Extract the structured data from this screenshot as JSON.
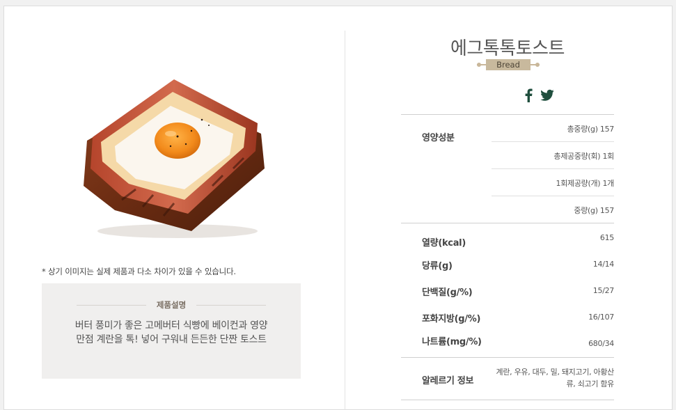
{
  "product": {
    "name": "에그톡톡토스트",
    "category": "Bread",
    "image_note": "* 상기 이미지는 실제 제품과 다소 차이가 있을 수 있습니다."
  },
  "description": {
    "title": "제품설명",
    "text": "버터 풍미가 좋은 고메버터 식빵에 베이컨과 영양만점 계란을 톡! 넣어 구워내 든든한 단짠 토스트"
  },
  "social": {
    "icons": [
      "facebook-icon",
      "twitter-icon"
    ],
    "color": "#1f4e3d"
  },
  "nutrition": {
    "section_label": "영양성분",
    "serving": [
      {
        "label": "총중량(g) 157"
      },
      {
        "label": "총제공중량(회) 1회"
      },
      {
        "label": "1회제공량(개) 1개"
      },
      {
        "label": "중량(g) 157"
      }
    ],
    "rows": [
      {
        "label": "열량(kcal)",
        "value": "615"
      },
      {
        "label": "당류(g)",
        "value": "14/14"
      },
      {
        "label": "단백질(g/%)",
        "value": "15/27"
      },
      {
        "label": "포화지방(g/%)",
        "value": "16/107"
      },
      {
        "label": "나트륨(mg/%)",
        "value": "680/34"
      }
    ],
    "allergy": {
      "label": "알레르기 정보",
      "line1": "계란, 우유, 대두, 밀, 돼지고기, 아황산",
      "line2": "류, 쇠고기 함유"
    }
  },
  "colors": {
    "badge": "#c8b99d",
    "desc_bg": "#f0efee",
    "accent_dark_green": "#1f4e3d"
  }
}
